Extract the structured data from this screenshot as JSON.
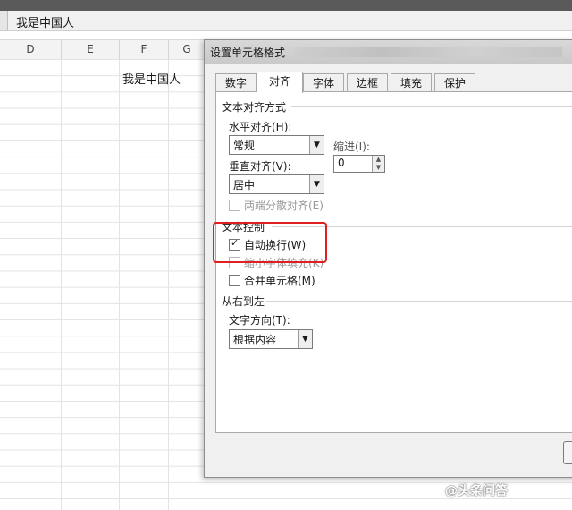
{
  "formula_bar": {
    "value": "我是中国人"
  },
  "columns": [
    "D",
    "E",
    "F",
    "G"
  ],
  "cell": {
    "text": "我是中国人"
  },
  "dialog": {
    "title": "设置单元格格式",
    "tabs": [
      "数字",
      "对齐",
      "字体",
      "边框",
      "填充",
      "保护"
    ],
    "active_tab": "对齐",
    "text_alignment": {
      "group_title": "文本对齐方式",
      "horizontal_label": "水平对齐(H):",
      "horizontal_value": "常规",
      "indent_label": "缩进(I):",
      "indent_value": "0",
      "vertical_label": "垂直对齐(V):",
      "vertical_value": "居中",
      "distributed_label": "两端分散对齐(E)"
    },
    "text_control": {
      "group_title": "文本控制",
      "wrap_label": "自动换行(W)",
      "wrap_checked": true,
      "shrink_label": "缩小字体填充(K)",
      "merge_label": "合并单元格(M)"
    },
    "rtl": {
      "group_title": "从右到左",
      "direction_label": "文字方向(T):",
      "direction_value": "根据内容"
    }
  },
  "watermark": "@头条问答",
  "colors": {
    "highlight": "#e02020"
  }
}
